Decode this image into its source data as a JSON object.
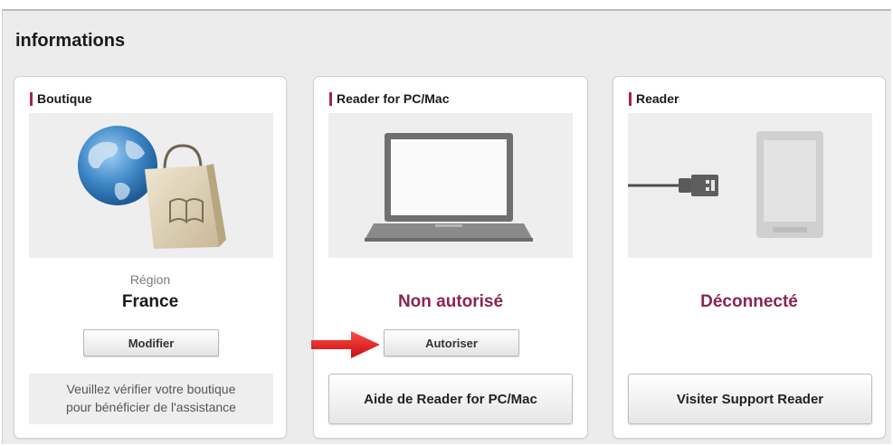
{
  "section": {
    "title": "informations"
  },
  "boutique": {
    "title": "Boutique",
    "region_label": "Région",
    "region_value": "France",
    "modify_button": "Modifier",
    "note_line1": "Veuillez vérifier votre boutique",
    "note_line2": "pour bénéficier de l'assistance",
    "illustration": "globe-shopping-bag-icon"
  },
  "reader_pc": {
    "title": "Reader for PC/Mac",
    "status": "Non autorisé",
    "authorize_button": "Autoriser",
    "help_button": "Aide de Reader for PC/Mac",
    "illustration": "laptop-icon"
  },
  "reader": {
    "title": "Reader",
    "status": "Déconnecté",
    "support_button": "Visiter Support Reader",
    "illustration": "usb-reader-device-icon"
  },
  "colors": {
    "accent": "#a3254c",
    "status_text": "#8a2453",
    "arrow": "#e0191b",
    "panel_bg": "#ececec",
    "illustration_bg": "#eeeeee"
  }
}
